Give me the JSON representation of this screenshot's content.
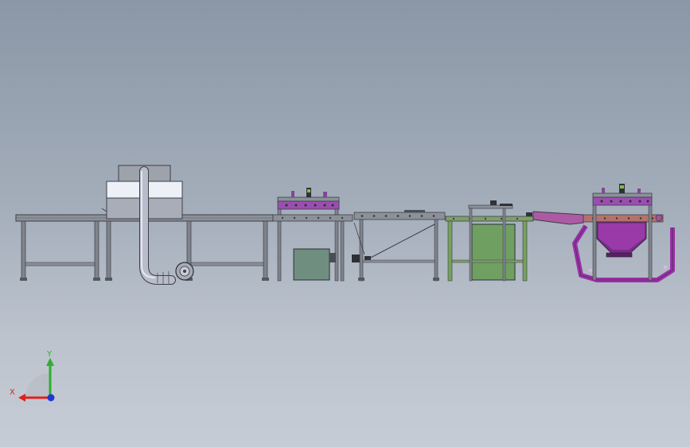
{
  "view": {
    "background_top": "#8b97a6",
    "background_bottom": "#c6ccd5"
  },
  "model": {
    "components": [
      {
        "id": "conveyor-1",
        "kind": "belt-conveyor",
        "color": "#8a8e96"
      },
      {
        "id": "dryer-hood",
        "kind": "hood",
        "color": "#e9ecf5"
      },
      {
        "id": "exhaust-duct",
        "kind": "duct",
        "color": "#b4b8c6"
      },
      {
        "id": "blower",
        "kind": "fan",
        "color": "#9ea3ae"
      },
      {
        "id": "roller-station-1",
        "kind": "roller-station",
        "color": "#8e4fa6"
      },
      {
        "id": "control-box-1",
        "kind": "cabinet",
        "color": "#6e8f7e"
      },
      {
        "id": "roller-conveyor",
        "kind": "roller-conveyor",
        "color": "#8a8e96"
      },
      {
        "id": "green-frame-station",
        "kind": "station",
        "color": "#6f9a5c"
      },
      {
        "id": "feed-chute",
        "kind": "chute",
        "color": "#a7509c"
      },
      {
        "id": "hopper-station",
        "kind": "hopper",
        "color": "#8f2f9b"
      }
    ]
  },
  "triad": {
    "x_label": "X",
    "y_label": "Y",
    "x_color": "#e0201c",
    "y_color": "#2fae2f",
    "z_color": "#1f35d6"
  }
}
